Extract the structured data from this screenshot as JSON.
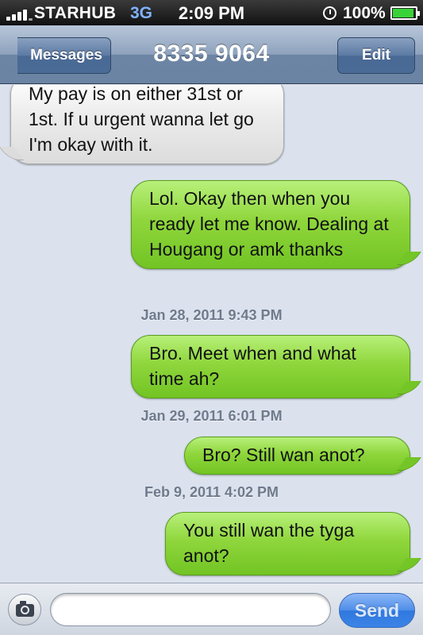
{
  "status_bar": {
    "carrier": "STARHUB",
    "network": "3G",
    "time": "2:09 PM",
    "battery": "100%"
  },
  "navbar": {
    "back_label": "Messages",
    "title": "8335 9064",
    "edit_label": "Edit"
  },
  "messages": [
    {
      "direction": "in",
      "text": "My pay is on either 31st or 1st. If u urgent wanna let go I'm okay with it."
    },
    {
      "direction": "out",
      "text": "Lol. Okay then when you ready let me know. Dealing at Hougang or amk thanks"
    },
    {
      "direction": "out",
      "text": "Bro. Meet when and what time ah?"
    },
    {
      "direction": "out",
      "text": "Bro? Still wan anot?"
    },
    {
      "direction": "out",
      "text": "You still wan the tyga anot?"
    }
  ],
  "timestamps": [
    "Jan 28, 2011 9:43 PM",
    "Jan 29, 2011 6:01 PM",
    "Feb 9, 2011 4:02 PM"
  ],
  "composer": {
    "input_value": "",
    "send_label": "Send"
  },
  "colors": {
    "incoming_bubble": "#e6e6e6",
    "outgoing_bubble": "#8fd63c",
    "thread_background": "#dbe2ed",
    "send_button": "#3c84e6"
  }
}
